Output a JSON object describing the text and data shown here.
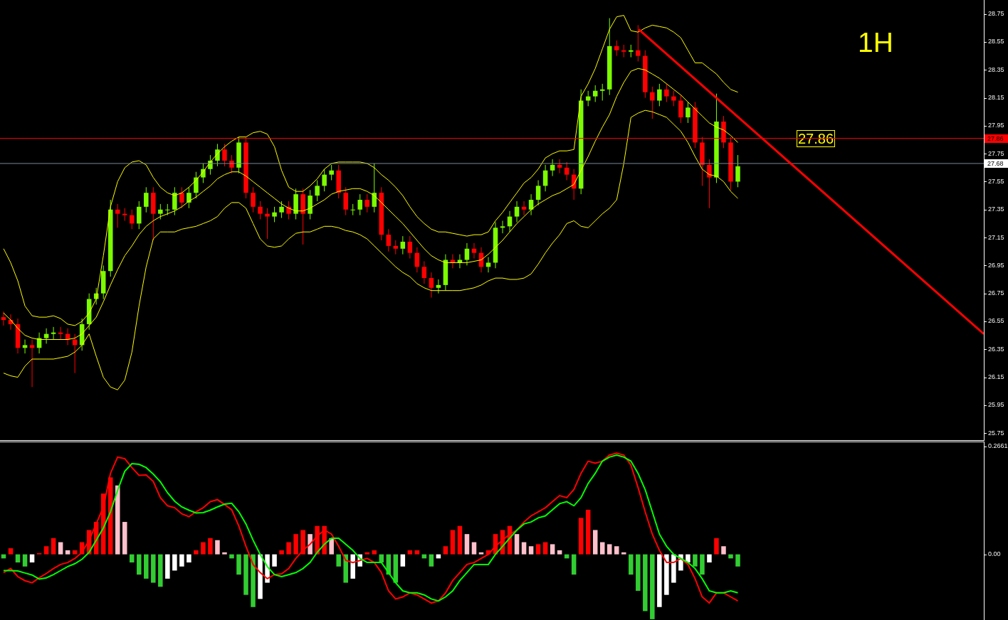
{
  "timeframe": "1H",
  "price_chart": {
    "chart_data": {
      "type": "candlestick",
      "ylim": [
        25.7,
        28.85
      ],
      "yticks": [
        {
          "value": 28.75,
          "label": "28.75"
        },
        {
          "value": 28.55,
          "label": "28.55"
        },
        {
          "value": 28.35,
          "label": "28.35"
        },
        {
          "value": 28.15,
          "label": "28.15"
        },
        {
          "value": 27.95,
          "label": "27.95"
        },
        {
          "value": 27.75,
          "label": "27.75"
        },
        {
          "value": 27.55,
          "label": "27.55"
        },
        {
          "value": 27.35,
          "label": "27.35"
        },
        {
          "value": 27.15,
          "label": "27.15"
        },
        {
          "value": 26.95,
          "label": "26.95"
        },
        {
          "value": 26.75,
          "label": "26.75"
        },
        {
          "value": 26.55,
          "label": "26.55"
        },
        {
          "value": 26.35,
          "label": "26.35"
        },
        {
          "value": 26.15,
          "label": "26.15"
        },
        {
          "value": 25.95,
          "label": "25.95"
        },
        {
          "value": 25.75,
          "label": "25.75"
        }
      ],
      "categories": [
        null,
        null,
        null,
        null,
        null,
        null,
        null,
        null,
        null,
        null,
        null,
        null,
        null,
        null,
        null,
        null,
        null,
        null,
        null,
        null,
        null,
        null,
        null,
        null,
        null,
        null,
        null,
        null,
        null,
        null,
        null,
        null,
        null,
        null,
        null,
        null,
        null,
        null,
        null,
        null,
        null,
        null,
        null,
        null,
        null,
        null,
        null,
        null,
        null,
        null,
        null,
        null,
        null,
        null,
        null,
        null,
        null,
        null,
        null,
        null,
        null,
        null,
        null,
        null,
        null,
        null,
        null,
        null,
        null,
        null,
        null,
        null,
        null,
        null,
        null,
        null,
        null,
        null,
        null,
        null,
        null,
        null,
        null,
        null,
        null,
        null,
        null,
        null,
        null,
        null,
        null,
        null,
        null,
        null,
        null,
        null,
        null,
        null,
        null,
        null,
        null,
        null,
        null,
        null,
        null,
        null,
        null,
        null,
        null,
        null,
        null,
        null,
        null,
        null,
        null,
        null,
        null,
        null,
        null,
        null,
        null,
        null,
        null,
        null,
        null,
        null,
        null,
        null,
        null,
        null,
        null,
        null,
        null,
        null,
        null,
        null,
        null,
        null
      ],
      "ohlc": [
        [
          26.58,
          26.62,
          26.52,
          26.56
        ],
        [
          26.56,
          26.6,
          26.49,
          26.53
        ],
        [
          26.53,
          26.57,
          26.32,
          26.36
        ],
        [
          26.36,
          26.42,
          26.32,
          26.38
        ],
        [
          26.38,
          26.42,
          26.08,
          26.36
        ],
        [
          26.36,
          26.47,
          26.32,
          26.43
        ],
        [
          26.43,
          26.5,
          26.39,
          26.46
        ],
        [
          26.46,
          26.51,
          26.42,
          26.47
        ],
        [
          26.47,
          26.51,
          26.42,
          26.46
        ],
        [
          26.46,
          26.5,
          26.38,
          26.42
        ],
        [
          26.42,
          26.46,
          26.18,
          26.38
        ],
        [
          26.38,
          26.57,
          26.34,
          26.53
        ],
        [
          26.53,
          26.75,
          26.49,
          26.71
        ],
        [
          26.71,
          26.79,
          26.67,
          26.75
        ],
        [
          26.75,
          26.95,
          26.71,
          26.91
        ],
        [
          26.91,
          27.42,
          26.87,
          27.35
        ],
        [
          27.35,
          27.39,
          27.22,
          27.32
        ],
        [
          27.32,
          27.36,
          27.27,
          27.31
        ],
        [
          27.31,
          27.35,
          27.21,
          27.25
        ],
        [
          27.25,
          27.41,
          27.21,
          27.37
        ],
        [
          27.37,
          27.51,
          27.33,
          27.47
        ],
        [
          27.47,
          27.51,
          27.13,
          27.32
        ],
        [
          27.32,
          27.39,
          27.28,
          27.35
        ],
        [
          27.35,
          27.39,
          27.31,
          27.35
        ],
        [
          27.35,
          27.51,
          27.31,
          27.47
        ],
        [
          27.47,
          27.51,
          27.36,
          27.4
        ],
        [
          27.4,
          27.51,
          27.36,
          27.47
        ],
        [
          27.47,
          27.62,
          27.43,
          27.58
        ],
        [
          27.58,
          27.68,
          27.54,
          27.64
        ],
        [
          27.64,
          27.74,
          27.6,
          27.7
        ],
        [
          27.7,
          27.82,
          27.66,
          27.78
        ],
        [
          27.78,
          27.82,
          27.66,
          27.7
        ],
        [
          27.7,
          27.74,
          27.61,
          27.65
        ],
        [
          27.65,
          27.87,
          27.61,
          27.83
        ],
        [
          27.83,
          27.87,
          27.43,
          27.47
        ],
        [
          27.47,
          27.51,
          27.33,
          27.37
        ],
        [
          27.37,
          27.41,
          27.28,
          27.32
        ],
        [
          27.32,
          27.36,
          27.14,
          27.3
        ],
        [
          27.3,
          27.37,
          27.26,
          27.33
        ],
        [
          27.33,
          27.41,
          27.29,
          27.37
        ],
        [
          27.37,
          27.41,
          27.28,
          27.32
        ],
        [
          27.32,
          27.5,
          27.28,
          27.46
        ],
        [
          27.46,
          27.5,
          27.1,
          27.32
        ],
        [
          27.32,
          27.49,
          27.28,
          27.45
        ],
        [
          27.45,
          27.56,
          27.41,
          27.52
        ],
        [
          27.52,
          27.64,
          27.48,
          27.6
        ],
        [
          27.6,
          27.67,
          27.56,
          27.63
        ],
        [
          27.63,
          27.67,
          27.43,
          27.47
        ],
        [
          27.47,
          27.51,
          27.31,
          27.35
        ],
        [
          27.35,
          27.39,
          27.31,
          27.35
        ],
        [
          27.35,
          27.46,
          27.31,
          27.42
        ],
        [
          27.42,
          27.46,
          27.33,
          27.37
        ],
        [
          27.37,
          27.68,
          27.33,
          27.47
        ],
        [
          27.47,
          27.51,
          27.13,
          27.17
        ],
        [
          27.17,
          27.21,
          27.05,
          27.09
        ],
        [
          27.09,
          27.13,
          27.03,
          27.07
        ],
        [
          27.07,
          27.16,
          27.03,
          27.12
        ],
        [
          27.12,
          27.16,
          27.0,
          27.04
        ],
        [
          27.04,
          27.08,
          26.9,
          26.94
        ],
        [
          26.94,
          26.98,
          26.82,
          26.86
        ],
        [
          26.86,
          26.9,
          26.72,
          26.79
        ],
        [
          26.79,
          26.85,
          26.75,
          26.81
        ],
        [
          26.81,
          27.03,
          26.77,
          26.99
        ],
        [
          26.99,
          27.03,
          26.93,
          26.97
        ],
        [
          26.97,
          27.03,
          26.93,
          26.99
        ],
        [
          26.99,
          27.11,
          26.95,
          27.07
        ],
        [
          27.07,
          27.11,
          27.0,
          27.04
        ],
        [
          27.04,
          27.08,
          26.9,
          26.94
        ],
        [
          26.94,
          27.01,
          26.9,
          26.97
        ],
        [
          26.97,
          27.26,
          26.93,
          27.22
        ],
        [
          27.22,
          27.27,
          27.18,
          27.23
        ],
        [
          27.23,
          27.34,
          27.19,
          27.3
        ],
        [
          27.3,
          27.41,
          27.26,
          27.37
        ],
        [
          27.37,
          27.41,
          27.31,
          27.35
        ],
        [
          27.35,
          27.46,
          27.31,
          27.42
        ],
        [
          27.42,
          27.56,
          27.38,
          27.52
        ],
        [
          27.52,
          27.67,
          27.48,
          27.63
        ],
        [
          27.63,
          27.71,
          27.59,
          27.67
        ],
        [
          27.67,
          27.71,
          27.61,
          27.65
        ],
        [
          27.65,
          27.69,
          27.56,
          27.6
        ],
        [
          27.6,
          27.64,
          27.42,
          27.5
        ],
        [
          27.5,
          28.21,
          27.46,
          28.13
        ],
        [
          28.13,
          28.2,
          28.09,
          28.16
        ],
        [
          28.16,
          28.24,
          28.12,
          28.2
        ],
        [
          28.2,
          28.25,
          28.13,
          28.21
        ],
        [
          28.21,
          28.72,
          28.17,
          28.52
        ],
        [
          28.52,
          28.56,
          28.45,
          28.49
        ],
        [
          28.49,
          28.53,
          28.44,
          28.48
        ],
        [
          28.48,
          28.53,
          28.44,
          28.49
        ],
        [
          28.49,
          28.67,
          28.41,
          28.45
        ],
        [
          28.45,
          28.49,
          28.15,
          28.19
        ],
        [
          28.19,
          28.23,
          28.0,
          28.13
        ],
        [
          28.13,
          28.25,
          28.09,
          28.21
        ],
        [
          28.21,
          28.25,
          28.12,
          28.16
        ],
        [
          28.16,
          28.2,
          28.09,
          28.13
        ],
        [
          28.13,
          28.17,
          27.97,
          28.01
        ],
        [
          28.01,
          28.12,
          27.97,
          28.08
        ],
        [
          28.08,
          28.12,
          27.79,
          27.83
        ],
        [
          27.83,
          27.87,
          27.52,
          27.67
        ],
        [
          27.67,
          27.71,
          27.36,
          27.58
        ],
        [
          27.58,
          28.18,
          27.54,
          27.98
        ],
        [
          27.98,
          28.02,
          27.79,
          27.83
        ],
        [
          27.83,
          27.87,
          27.49,
          27.55
        ],
        [
          27.55,
          27.74,
          27.51,
          27.66
        ],
        null,
        null,
        null,
        null,
        null,
        null,
        null,
        null,
        null,
        null,
        null,
        null,
        null,
        null,
        null,
        null,
        null,
        null,
        null,
        null,
        null,
        null,
        null,
        null,
        null,
        null,
        null,
        null,
        null,
        null,
        null,
        null,
        null,
        null
      ],
      "annotations": [
        "27.86"
      ]
    }
  },
  "bands_chart": {
    "chart_data": {
      "type": "line",
      "ylim": [
        25.7,
        28.85
      ],
      "yticks": [
        {
          "value": 27.86,
          "label": "27.86"
        },
        {
          "value": 27.68,
          "label": "27.68"
        }
      ],
      "categories": [
        null,
        null,
        null,
        null,
        null,
        null,
        null,
        null,
        null,
        null,
        null,
        null,
        null,
        null,
        null,
        null,
        null,
        null,
        null,
        null,
        null,
        null,
        null,
        null,
        null,
        null,
        null,
        null,
        null,
        null,
        null,
        null,
        null,
        null,
        null,
        null,
        null,
        null,
        null,
        null,
        null,
        null,
        null,
        null,
        null,
        null,
        null,
        null,
        null,
        null,
        null,
        null,
        null,
        null,
        null,
        null,
        null,
        null,
        null,
        null,
        null,
        null,
        null,
        null,
        null,
        null,
        null,
        null,
        null,
        null,
        null,
        null,
        null,
        null,
        null,
        null,
        null,
        null,
        null,
        null,
        null,
        null,
        null,
        null,
        null,
        null,
        null,
        null,
        null,
        null,
        null,
        null,
        null,
        null,
        null,
        null,
        null,
        null,
        null,
        null,
        null,
        null,
        null,
        null,
        null,
        null,
        null,
        null,
        null,
        null,
        null,
        null,
        null,
        null,
        null,
        null,
        null,
        null,
        null,
        null,
        null,
        null,
        null,
        null,
        null,
        null,
        null,
        null,
        null,
        null,
        null,
        null,
        null,
        null,
        null,
        null,
        null,
        null
      ],
      "series": [
        {
          "color": "#ffff00",
          "values": [
            27.07,
            26.97,
            26.84,
            26.66,
            26.59,
            26.58,
            26.58,
            26.59,
            26.57,
            26.53,
            26.52,
            26.55,
            26.61,
            26.71,
            27.02,
            27.37,
            27.55,
            27.65,
            27.69,
            27.7,
            27.67,
            27.58,
            27.51,
            27.47,
            27.45,
            27.47,
            27.51,
            27.56,
            27.62,
            27.69,
            27.75,
            27.8,
            27.84,
            27.87,
            27.87,
            27.9,
            27.91,
            27.89,
            27.8,
            27.63,
            27.51,
            27.48,
            27.48,
            27.52,
            27.57,
            27.64,
            27.68,
            27.69,
            27.69,
            27.69,
            27.69,
            27.68,
            27.65,
            27.6,
            27.56,
            27.51,
            27.45,
            27.37,
            27.3,
            27.25,
            27.21,
            27.19,
            27.19,
            27.18,
            27.17,
            27.16,
            27.17,
            27.17,
            27.19,
            27.27,
            27.33,
            27.4,
            27.47,
            27.54,
            27.58,
            27.64,
            27.72,
            27.75,
            27.77,
            27.77,
            27.78,
            28.16,
            28.25,
            28.36,
            28.5,
            28.64,
            28.73,
            28.74,
            28.63,
            28.62,
            28.65,
            28.67,
            28.66,
            28.65,
            28.62,
            28.58,
            28.49,
            28.4,
            28.4,
            28.36,
            28.32,
            28.26,
            28.21,
            28.19,
            null,
            null,
            null,
            null,
            null,
            null,
            null,
            null,
            null,
            null,
            null,
            null,
            null,
            null,
            null,
            null,
            null,
            null,
            null,
            null,
            null,
            null,
            null,
            null,
            null,
            null,
            null,
            null,
            null,
            null,
            null,
            null,
            null,
            null
          ]
        },
        {
          "color": "#ffff00",
          "values": [
            26.61,
            26.56,
            26.5,
            26.45,
            26.43,
            26.42,
            26.42,
            26.42,
            26.42,
            26.42,
            26.43,
            26.46,
            26.52,
            26.58,
            26.69,
            26.81,
            26.92,
            27.02,
            27.09,
            27.17,
            27.23,
            27.27,
            27.3,
            27.32,
            27.34,
            27.37,
            27.41,
            27.44,
            27.48,
            27.52,
            27.57,
            27.6,
            27.62,
            27.62,
            27.59,
            27.55,
            27.51,
            27.47,
            27.43,
            27.39,
            27.36,
            27.34,
            27.34,
            27.36,
            27.39,
            27.42,
            27.46,
            27.48,
            27.49,
            27.5,
            27.5,
            27.48,
            27.45,
            27.4,
            27.35,
            27.3,
            27.25,
            27.19,
            27.13,
            27.07,
            27.02,
            26.99,
            26.97,
            26.97,
            26.97,
            26.97,
            26.98,
            26.99,
            27.03,
            27.08,
            27.13,
            27.19,
            27.25,
            27.3,
            27.35,
            27.39,
            27.42,
            27.45,
            27.47,
            27.5,
            27.53,
            27.63,
            27.73,
            27.84,
            27.94,
            28.03,
            28.16,
            28.26,
            28.34,
            28.36,
            28.35,
            28.32,
            28.29,
            28.25,
            28.21,
            28.17,
            28.12,
            28.07,
            28.02,
            27.97,
            27.94,
            27.92,
            27.88,
            27.83,
            null,
            null,
            null,
            null,
            null,
            null,
            null,
            null,
            null,
            null,
            null,
            null,
            null,
            null,
            null,
            null,
            null,
            null,
            null,
            null,
            null,
            null,
            null,
            null,
            null,
            null,
            null,
            null,
            null,
            null,
            null,
            null,
            null,
            null
          ]
        },
        {
          "color": "#ffff00",
          "values": [
            26.18,
            26.16,
            26.15,
            26.23,
            26.28,
            26.28,
            26.28,
            26.28,
            26.29,
            26.3,
            26.33,
            26.38,
            26.46,
            26.3,
            26.15,
            26.08,
            26.06,
            26.13,
            26.33,
            26.66,
            26.94,
            27.14,
            27.19,
            27.19,
            27.19,
            27.21,
            27.22,
            27.23,
            27.25,
            27.27,
            27.3,
            27.36,
            27.4,
            27.4,
            27.36,
            27.25,
            27.14,
            27.09,
            27.08,
            27.09,
            27.14,
            27.18,
            27.19,
            27.19,
            27.21,
            27.23,
            27.23,
            27.22,
            27.2,
            27.19,
            27.17,
            27.14,
            27.09,
            27.04,
            26.99,
            26.94,
            26.9,
            26.87,
            26.82,
            26.79,
            26.77,
            26.77,
            26.77,
            26.77,
            26.77,
            26.78,
            26.79,
            26.81,
            26.84,
            26.86,
            26.86,
            26.85,
            26.85,
            26.86,
            26.89,
            26.96,
            27.04,
            27.11,
            27.17,
            27.25,
            27.27,
            27.23,
            27.22,
            27.27,
            27.32,
            27.36,
            27.42,
            27.68,
            28.01,
            28.04,
            28.06,
            28.05,
            28.03,
            28.01,
            27.96,
            27.91,
            27.83,
            27.73,
            27.64,
            27.6,
            27.59,
            27.55,
            27.48,
            27.43,
            null,
            null,
            null,
            null,
            null,
            null,
            null,
            null,
            null,
            null,
            null,
            null,
            null,
            null,
            null,
            null,
            null,
            null,
            null,
            null,
            null,
            null,
            null,
            null,
            null,
            null,
            null,
            null,
            null,
            null,
            null,
            null,
            null,
            null
          ]
        }
      ],
      "ref_lines": [
        {
          "axis": "y",
          "value": 27.86,
          "color": "#ff0000"
        },
        {
          "axis": "y",
          "value": 27.68,
          "color": "#778899"
        }
      ]
    }
  },
  "macd_chart": {
    "chart_data": {
      "type": "bar",
      "ylim": [
        -0.162,
        0.2766
      ],
      "yticks": [
        {
          "value": 0.2661,
          "label": "0.2661"
        },
        {
          "value": 0,
          "label": "0.00"
        }
      ],
      "categories": [
        null,
        null,
        null,
        null,
        null,
        null,
        null,
        null,
        null,
        null,
        null,
        null,
        null,
        null,
        null,
        null,
        null,
        null,
        null,
        null,
        null,
        null,
        null,
        null,
        null,
        null,
        null,
        null,
        null,
        null,
        null,
        null,
        null,
        null,
        null,
        null,
        null,
        null,
        null,
        null,
        null,
        null,
        null,
        null,
        null,
        null,
        null,
        null,
        null,
        null,
        null,
        null,
        null,
        null,
        null,
        null,
        null,
        null,
        null,
        null,
        null,
        null,
        null,
        null,
        null,
        null,
        null,
        null,
        null,
        null,
        null,
        null,
        null,
        null,
        null,
        null,
        null,
        null,
        null,
        null,
        null,
        null,
        null,
        null,
        null,
        null,
        null,
        null,
        null,
        null,
        null,
        null,
        null,
        null,
        null,
        null,
        null,
        null,
        null,
        null,
        null,
        null,
        null,
        null,
        null,
        null,
        null,
        null,
        null,
        null,
        null,
        null,
        null,
        null,
        null,
        null,
        null,
        null,
        null,
        null,
        null,
        null,
        null,
        null,
        null,
        null,
        null,
        null,
        null,
        null,
        null,
        null,
        null,
        null,
        null,
        null,
        null,
        null
      ],
      "series": [
        {
          "colors": [
            "#32cd32",
            "#ff0000",
            "#32cd32",
            "#32cd32",
            "#ffffff",
            "#ff0000",
            "#ff0000",
            "#ff0000",
            "#ffc0cb",
            "#ffc0cb",
            "#ff0000",
            "#ff0000",
            "#ff0000",
            "#ff0000",
            "#ff0000",
            "#ff0000",
            "#ffc0cb",
            "#ffc0cb",
            "#32cd32",
            "#32cd32",
            "#32cd32",
            "#32cd32",
            "#32cd32",
            "#ffffff",
            "#ffffff",
            "#ffffff",
            "#ffffff",
            "#ff0000",
            "#ff0000",
            "#ff0000",
            "#ffc0cb",
            "#ffc0cb",
            "#32cd32",
            "#32cd32",
            "#32cd32",
            "#32cd32",
            "#ffffff",
            "#ffffff",
            "#ffffff",
            "#ff0000",
            "#ff0000",
            "#ff0000",
            "#ff0000",
            "#ffc0cb",
            "#ff0000",
            "#ff0000",
            "#ffc0cb",
            "#32cd32",
            "#32cd32",
            "#ffffff",
            "#ffffff",
            "#ff0000",
            "#ff0000",
            "#32cd32",
            "#32cd32",
            "#32cd32",
            "#ffffff",
            "#ff0000",
            "#ff0000",
            "#32cd32",
            "#32cd32",
            "#ffffff",
            "#ff0000",
            "#ff0000",
            "#ff0000",
            "#ffc0cb",
            "#ffc0cb",
            "#ffc0cb",
            "#ff0000",
            "#ff0000",
            "#ff0000",
            "#ff0000",
            "#ffc0cb",
            "#ffc0cb",
            "#ffc0cb",
            "#ff0000",
            "#ff0000",
            "#ffc0cb",
            "#ffc0cb",
            "#32cd32",
            "#32cd32",
            "#ff0000",
            "#ff0000",
            "#ffc0cb",
            "#ffc0cb",
            "#ffc0cb",
            "#ffc0cb",
            "#ffc0cb",
            "#32cd32",
            "#32cd32",
            "#32cd32",
            "#32cd32",
            "#ffffff",
            "#ffffff",
            "#ffffff",
            "#ffffff",
            "#ffffff",
            "#32cd32",
            "#32cd32",
            "#ffffff",
            "#ff0000",
            "#ffc0cb",
            "#32cd32",
            "#32cd32",
            null,
            null,
            null,
            null,
            null,
            null,
            null,
            null,
            null,
            null,
            null,
            null,
            null,
            null,
            null,
            null,
            null,
            null,
            null,
            null,
            null,
            null,
            null,
            null,
            null,
            null,
            null,
            null,
            null,
            null,
            null,
            null,
            null,
            null
          ],
          "values": [
            -0.01,
            0.015,
            -0.02,
            -0.03,
            -0.02,
            0.003,
            0.02,
            0.04,
            0.03,
            0.01,
            0.01,
            0.03,
            0.06,
            0.08,
            0.15,
            0.19,
            0.17,
            0.08,
            -0.02,
            -0.05,
            -0.06,
            -0.07,
            -0.08,
            -0.06,
            -0.04,
            -0.03,
            -0.02,
            0.01,
            0.03,
            0.04,
            0.035,
            0.005,
            -0.01,
            -0.05,
            -0.1,
            -0.13,
            -0.11,
            -0.07,
            -0.03,
            0.01,
            0.03,
            0.05,
            0.06,
            0.05,
            0.07,
            0.07,
            0.04,
            -0.03,
            -0.07,
            -0.06,
            -0.03,
            0.005,
            0.01,
            -0.02,
            -0.05,
            -0.07,
            -0.03,
            0.01,
            0.01,
            -0.01,
            -0.03,
            -0.01,
            0.02,
            0.06,
            0.07,
            0.05,
            0.03,
            0.005,
            0.01,
            0.05,
            0.06,
            0.07,
            0.05,
            0.03,
            0.02,
            0.025,
            0.03,
            0.025,
            0.01,
            -0.01,
            -0.05,
            0.09,
            0.11,
            0.06,
            0.03,
            0.025,
            0.02,
            0.005,
            -0.05,
            -0.09,
            -0.14,
            -0.16,
            -0.13,
            -0.1,
            -0.07,
            -0.04,
            -0.02,
            -0.03,
            -0.05,
            -0.02,
            0.04,
            0.02,
            -0.01,
            -0.03,
            null,
            null,
            null,
            null,
            null,
            null,
            null,
            null,
            null,
            null,
            null,
            null,
            null,
            null,
            null,
            null,
            null,
            null,
            null,
            null,
            null,
            null,
            null,
            null,
            null,
            null,
            null,
            null,
            null,
            null,
            null,
            null,
            null,
            null
          ]
        },
        {
          "type": "line",
          "color": "#ff0000",
          "values": [
            -0.045,
            -0.035,
            -0.055,
            -0.065,
            -0.07,
            -0.058,
            -0.047,
            -0.035,
            -0.025,
            -0.02,
            -0.01,
            0.005,
            0.035,
            0.075,
            0.117,
            0.2,
            0.24,
            0.236,
            0.214,
            0.195,
            0.196,
            0.18,
            0.14,
            0.12,
            0.115,
            0.1,
            0.093,
            0.105,
            0.115,
            0.13,
            0.135,
            0.123,
            0.11,
            0.07,
            0.02,
            -0.025,
            -0.045,
            -0.06,
            -0.05,
            -0.048,
            -0.035,
            -0.01,
            0.01,
            0.025,
            0.045,
            0.06,
            0.05,
            0.02,
            -0.015,
            -0.02,
            -0.015,
            -0.01,
            -0.02,
            -0.045,
            -0.09,
            -0.11,
            -0.105,
            -0.095,
            -0.1,
            -0.11,
            -0.12,
            -0.115,
            -0.095,
            -0.065,
            -0.045,
            -0.025,
            -0.02,
            -0.01,
            0.0,
            0.02,
            0.035,
            0.05,
            0.06,
            0.08,
            0.095,
            0.105,
            0.115,
            0.13,
            0.145,
            0.14,
            0.16,
            0.2,
            0.23,
            0.225,
            0.23,
            0.245,
            0.25,
            0.245,
            0.22,
            0.165,
            0.105,
            0.05,
            0.01,
            -0.02,
            -0.02,
            -0.01,
            -0.025,
            -0.06,
            -0.105,
            -0.12,
            -0.095,
            -0.095,
            -0.105,
            -0.115,
            null,
            null,
            null,
            null,
            null,
            null,
            null,
            null,
            null,
            null,
            null,
            null,
            null,
            null,
            null,
            null,
            null,
            null,
            null,
            null,
            null,
            null,
            null,
            null,
            null,
            null,
            null,
            null,
            null,
            null,
            null,
            null,
            null,
            null
          ]
        },
        {
          "type": "line",
          "color": "#00ff00",
          "values": [
            -0.04,
            -0.04,
            -0.041,
            -0.046,
            -0.051,
            -0.061,
            -0.058,
            -0.05,
            -0.04,
            -0.03,
            -0.023,
            -0.012,
            0.005,
            0.035,
            0.065,
            0.105,
            0.158,
            0.205,
            0.224,
            0.222,
            0.214,
            0.198,
            0.179,
            0.152,
            0.131,
            0.117,
            0.109,
            0.102,
            0.103,
            0.109,
            0.117,
            0.124,
            0.126,
            0.105,
            0.075,
            0.035,
            0.0,
            -0.03,
            -0.05,
            -0.055,
            -0.05,
            -0.045,
            -0.035,
            -0.02,
            0.005,
            0.025,
            0.04,
            0.04,
            0.025,
            0.01,
            -0.01,
            -0.02,
            -0.02,
            -0.02,
            -0.045,
            -0.07,
            -0.09,
            -0.095,
            -0.095,
            -0.1,
            -0.11,
            -0.115,
            -0.105,
            -0.09,
            -0.065,
            -0.045,
            -0.025,
            -0.025,
            -0.025,
            0.0,
            0.02,
            0.04,
            0.06,
            0.075,
            0.08,
            0.09,
            0.095,
            0.11,
            0.125,
            0.13,
            0.12,
            0.14,
            0.175,
            0.2,
            0.23,
            0.24,
            0.245,
            0.24,
            0.23,
            0.2,
            0.16,
            0.105,
            0.05,
            0.02,
            0.0,
            -0.01,
            -0.02,
            -0.035,
            -0.06,
            -0.09,
            -0.095,
            -0.095,
            -0.09,
            -0.095,
            null,
            null,
            null,
            null,
            null,
            null,
            null,
            null,
            null,
            null,
            null,
            null,
            null,
            null,
            null,
            null,
            null,
            null,
            null,
            null,
            null,
            null,
            null,
            null,
            null,
            null,
            null,
            null,
            null,
            null,
            null,
            null,
            null,
            null
          ]
        }
      ]
    }
  }
}
